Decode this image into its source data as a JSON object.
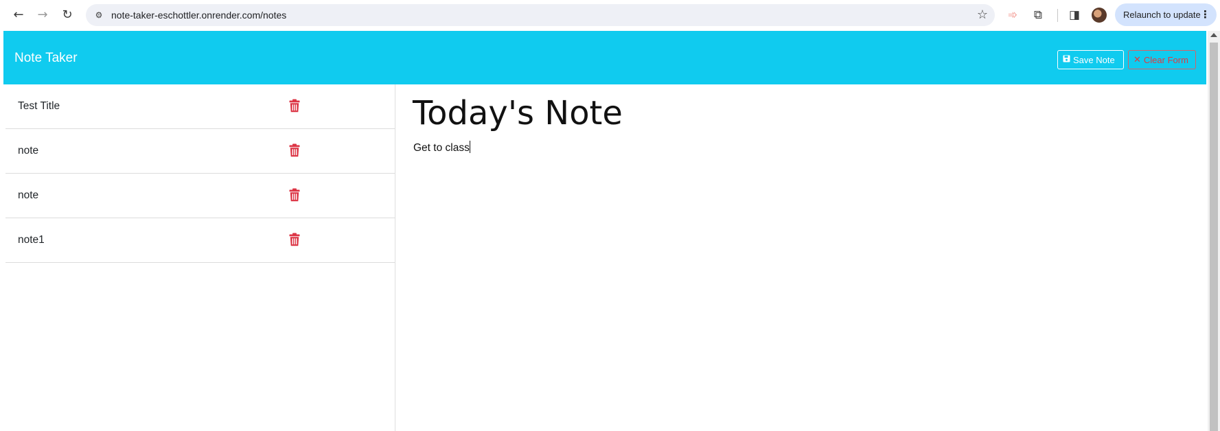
{
  "browser": {
    "url": "note-taker-eschottler.onrender.com/notes",
    "relaunch_label": "Relaunch to update",
    "icons": {
      "back": "back-arrow-icon",
      "forward": "forward-arrow-icon",
      "reload": "reload-icon",
      "site_info": "site-settings-icon",
      "bookmark": "star-icon",
      "extension": "puzzle-icon",
      "side_panel": "side-panel-icon",
      "menu": "kebab-menu-icon"
    },
    "colors": {
      "omnibox_bg": "#eef0f6",
      "relaunch_bg": "#d3e3fd"
    }
  },
  "app": {
    "brand": "Note Taker",
    "header_color": "#10cbef",
    "save_label": "Save Note",
    "clear_label": "Clear Form",
    "save_icon": "floppy-disk-icon",
    "clear_icon": "x-icon",
    "delete_icon": "trash-icon",
    "delete_color": "#dc3545",
    "notes": [
      {
        "title": "Test Title"
      },
      {
        "title": "note"
      },
      {
        "title": "note"
      },
      {
        "title": "note1"
      }
    ],
    "active_note": {
      "title": "Today's Note",
      "text": "Get to class"
    }
  }
}
